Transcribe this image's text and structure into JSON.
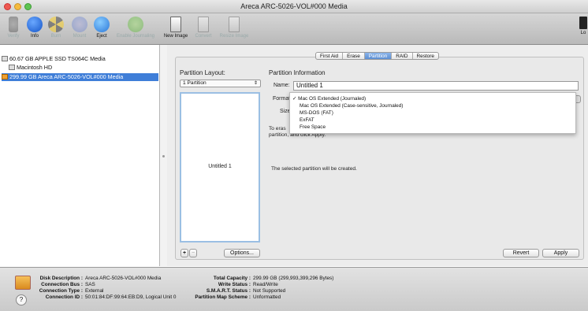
{
  "window": {
    "title": "Areca ARC-5026-VOL#000 Media"
  },
  "toolbar": {
    "items": [
      {
        "label": "Verify",
        "icon": "microscope-icon",
        "enabled": false
      },
      {
        "label": "Info",
        "icon": "info-icon",
        "enabled": true
      },
      {
        "label": "Burn",
        "icon": "burn-icon",
        "enabled": false
      },
      {
        "label": "Mount",
        "icon": "mount-icon",
        "enabled": false
      },
      {
        "label": "Eject",
        "icon": "eject-icon",
        "enabled": true
      },
      {
        "label": "Enable Journaling",
        "icon": "journaling-icon",
        "enabled": false
      },
      {
        "label": "New Image",
        "icon": "new-image-icon",
        "enabled": true
      },
      {
        "label": "Convert",
        "icon": "convert-icon",
        "enabled": false
      },
      {
        "label": "Resize Image",
        "icon": "resize-image-icon",
        "enabled": false
      }
    ],
    "log_label": "Lo"
  },
  "sidebar": {
    "items": [
      {
        "label": "60.67 GB APPLE SSD TS064C Media",
        "icon": "disk-icon"
      },
      {
        "label": "Macintosh HD",
        "icon": "volume-icon"
      },
      {
        "label": "299.99 GB Areca ARC-5026-VOL#000 Media",
        "icon": "external-disk-icon",
        "selected": true
      }
    ]
  },
  "tabs": [
    "First Aid",
    "Erase",
    "Partition",
    "RAID",
    "Restore"
  ],
  "partition": {
    "layout_label": "Partition Layout:",
    "layout_value": "1 Partition",
    "map_label": "Untitled 1",
    "info_heading": "Partition Information",
    "name_label": "Name:",
    "name_value": "Untitled 1",
    "format_label": "Format",
    "size_label": "Size",
    "format_options": [
      {
        "label": "Mac OS Extended (Journaled)",
        "checked": true
      },
      {
        "label": "Mac OS Extended (Case-sensitive, Journaled)",
        "checked": false
      },
      {
        "label": "MS-DOS (FAT)",
        "checked": false
      },
      {
        "label": "ExFAT",
        "checked": false
      },
      {
        "label": "Free Space",
        "checked": false
      }
    ],
    "check_mark": "✓",
    "desc_line1": "To eras",
    "desc_line2": "partition, and click Apply.",
    "created_text": "The selected partition will be created.",
    "add_label": "+",
    "remove_label": "−",
    "options_label": "Options...",
    "revert_label": "Revert",
    "apply_label": "Apply"
  },
  "info": {
    "left": [
      {
        "key": "Disk Description :",
        "value": "Areca ARC-5026-VOL#000 Media"
      },
      {
        "key": "Connection Bus :",
        "value": "SAS"
      },
      {
        "key": "Connection Type :",
        "value": "External"
      },
      {
        "key": "Connection ID :",
        "value": "50:01:84:DF:99:64:EB:D9, Logical Unit 0"
      }
    ],
    "right": [
      {
        "key": "Total Capacity :",
        "value": "299.99 GB (299,993,399,296 Bytes)"
      },
      {
        "key": "Write Status :",
        "value": "Read/Write"
      },
      {
        "key": "S.M.A.R.T. Status :",
        "value": "Not Supported"
      },
      {
        "key": "Partition Map Scheme :",
        "value": "Unformatted"
      }
    ],
    "help_label": "?"
  },
  "colors": {
    "selection": "#3f7ed8",
    "accent_tab": "#5d8fd2"
  }
}
